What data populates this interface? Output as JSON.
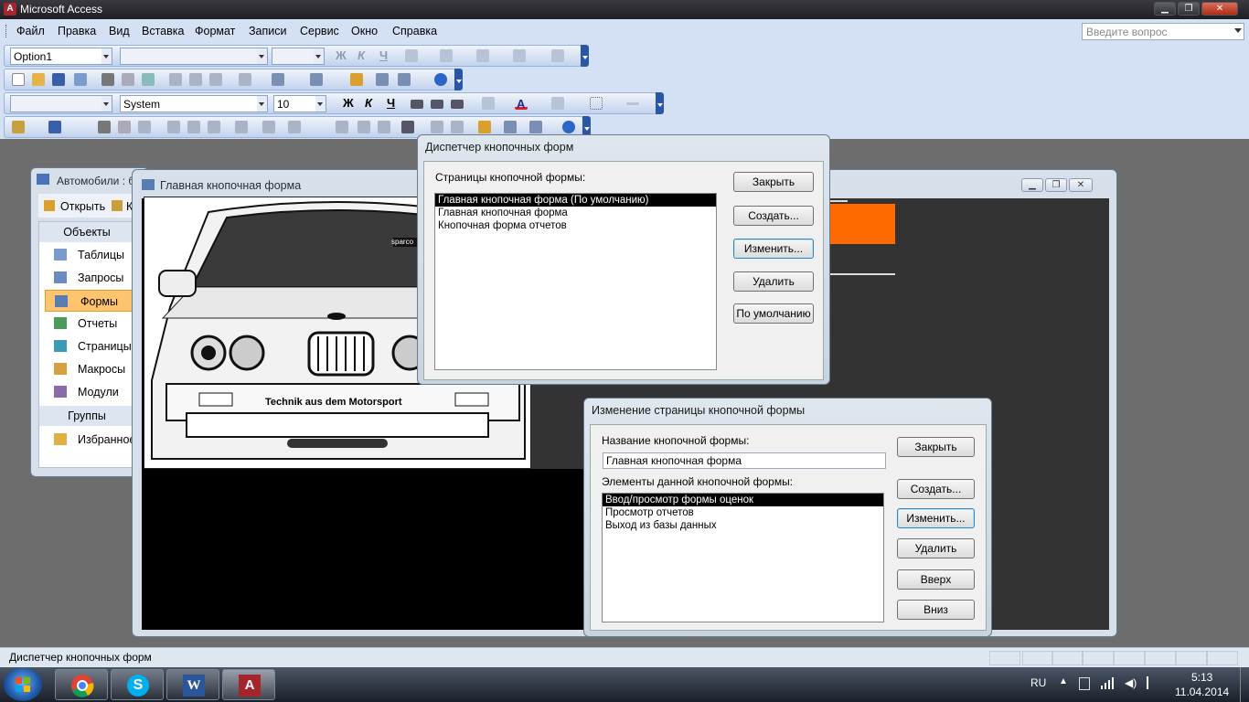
{
  "app": {
    "title": "Microsoft Access"
  },
  "menu": [
    "Файл",
    "Правка",
    "Вид",
    "Вставка",
    "Формат",
    "Записи",
    "Сервис",
    "Окно",
    "Справка"
  ],
  "ask_box": {
    "placeholder": "Введите вопрос"
  },
  "toolbar1": {
    "object_combo": "Option1"
  },
  "toolbar3": {
    "font": "System",
    "size": "10",
    "bold": "Ж",
    "italic": "К",
    "underline": "Ч"
  },
  "toolbar1_fmt": {
    "bold": "Ж",
    "italic": "К",
    "underline": "Ч"
  },
  "db_window": {
    "title": "Автомобили : б",
    "open_label": "Открыть",
    "k_label": "К",
    "objects_header": "Объекты",
    "objects": [
      "Таблицы",
      "Запросы",
      "Формы",
      "Отчеты",
      "Страницы",
      "Макросы",
      "Модули"
    ],
    "selected": "Формы",
    "groups_header": "Группы",
    "favorites": "Избранное"
  },
  "form_window": {
    "title": "Главная кнопочная форма",
    "photo_text": "Technik aus dem Motorsport",
    "sparco": "sparco"
  },
  "switchboard_manager": {
    "title": "Диспетчер кнопочных форм",
    "pages_label": "Страницы кнопочной формы:",
    "pages": [
      "Главная кнопочная форма (По умолчанию)",
      "Главная кнопочная форма",
      "Кнопочная форма отчетов"
    ],
    "buttons": {
      "close": "Закрыть",
      "create": "Создать...",
      "edit": "Изменить...",
      "delete": "Удалить",
      "default": "По умолчанию"
    }
  },
  "edit_page": {
    "title": "Изменение страницы кнопочной формы",
    "name_label": "Название кнопочной формы:",
    "name_value": "Главная кнопочная форма",
    "items_label": "Элементы данной кнопочной формы:",
    "items": [
      "Ввод/просмотр формы оценок",
      "Просмотр отчетов",
      "Выход из базы данных"
    ],
    "buttons": {
      "close": "Закрыть",
      "create": "Создать...",
      "edit": "Изменить...",
      "delete": "Удалить",
      "up": "Вверх",
      "down": "Вниз"
    }
  },
  "status": {
    "text": "Диспетчер кнопочных форм"
  },
  "tray": {
    "lang": "RU",
    "time": "5:13",
    "date": "11.04.2014"
  },
  "colors": {
    "accent_orange": "#ff6a00",
    "toolbar_bg": "#d4e0f3",
    "menu_bg": "#d4e0f3",
    "selection": "#000000"
  }
}
